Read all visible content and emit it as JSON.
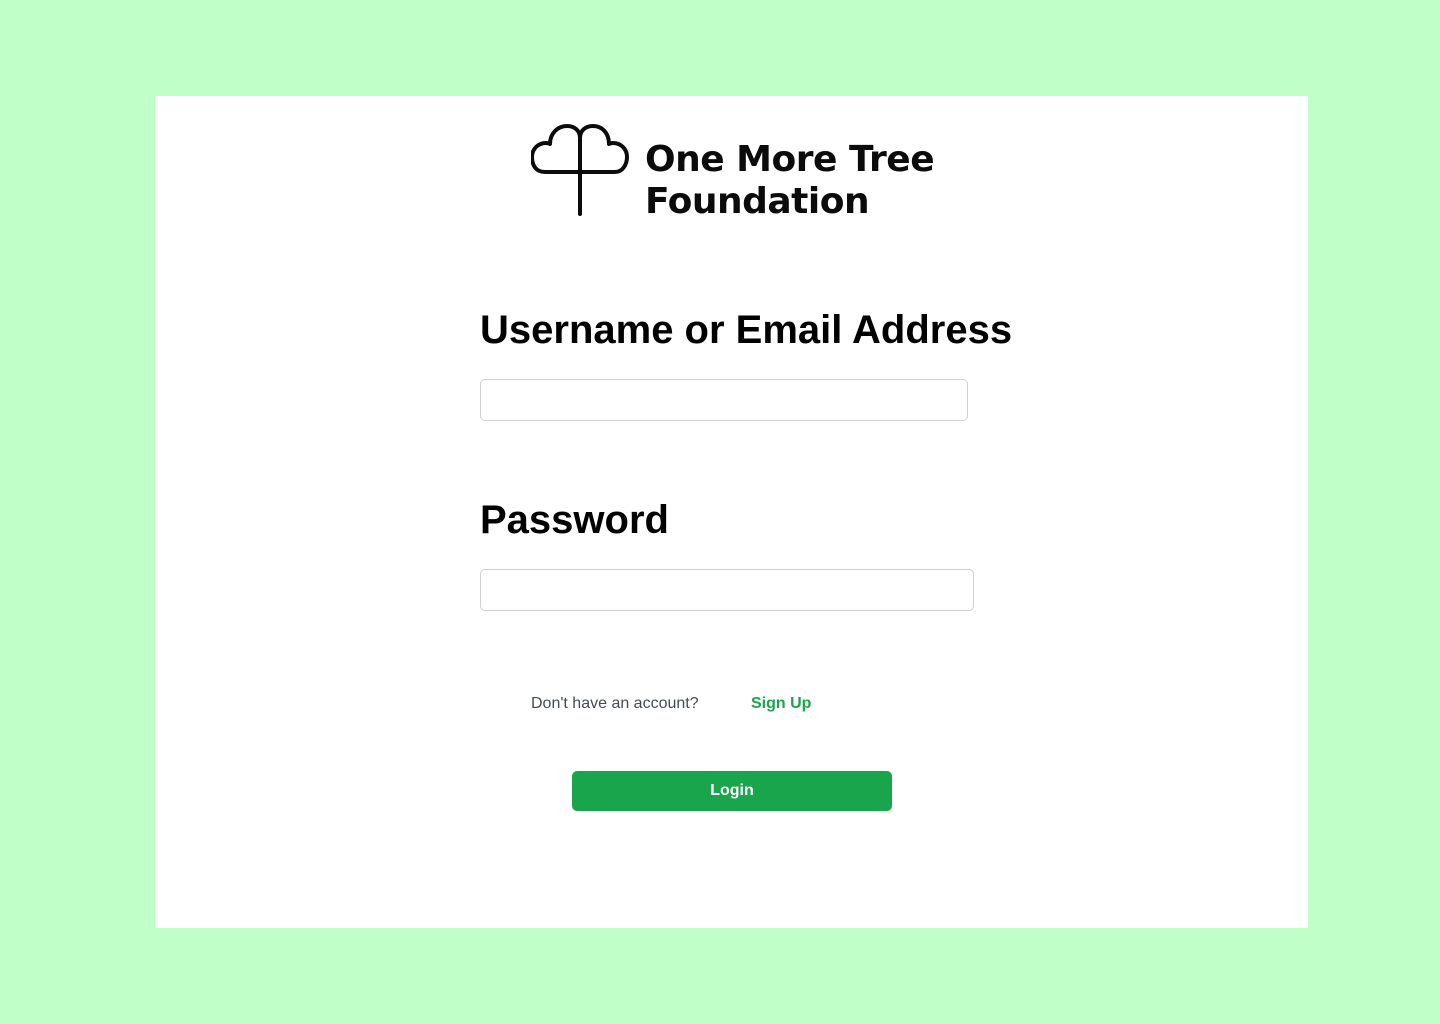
{
  "brand": {
    "name_line1": "One More Tree",
    "name_line2": "Foundation",
    "logo_icon": "tree-icon"
  },
  "form": {
    "username_label": "Username or Email Address",
    "username_value": "",
    "password_label": "Password",
    "password_value": "",
    "signup_prompt": "Don't have an account?",
    "signup_link": "Sign Up",
    "login_button": "Login"
  },
  "colors": {
    "page_background": "#c1ffc8",
    "card_background": "#ffffff",
    "accent_green": "#19a54c",
    "link_green": "#1aa64b",
    "text_dark": "#000000",
    "text_muted": "#444b55"
  }
}
